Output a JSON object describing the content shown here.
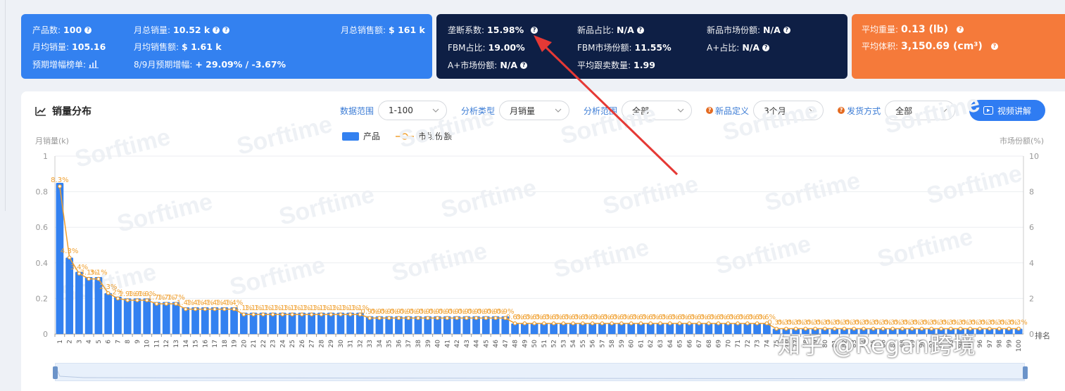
{
  "summary_blue": {
    "product_count_label": "产品数:",
    "product_count": "100",
    "monthly_sales_label": "月总销量:",
    "monthly_sales": "10.52 k",
    "monthly_revenue_label": "月总销售额:",
    "monthly_revenue": "$ 161 k",
    "avg_sales_label": "月均销量:",
    "avg_sales": "105.16",
    "avg_revenue_label": "月均销售额:",
    "avg_revenue": "$ 1.61 k",
    "forecast_label": "预期增幅榜单:",
    "aug_sep_label": "8/9月预期增幅:",
    "aug_sep_value": "+ 29.09% / -3.67%"
  },
  "summary_navy": {
    "monopoly_label": "垄断系数:",
    "monopoly_value": "15.98%",
    "new_ratio_label": "新品占比:",
    "new_ratio_value": "N/A",
    "new_share_label": "新品市场份额:",
    "new_share_value": "N/A",
    "fbm_ratio_label": "FBM占比:",
    "fbm_ratio_value": "19.00%",
    "fbm_share_label": "FBM市场份额:",
    "fbm_share_value": "11.55%",
    "aplus_ratio_label": "A+占比:",
    "aplus_ratio_value": "N/A",
    "aplus_share_label": "A+市场份额:",
    "aplus_share_value": "N/A",
    "avg_sellers_label": "平均跟卖数量:",
    "avg_sellers_value": "1.99"
  },
  "summary_orange": {
    "avg_weight_label": "平均重量:",
    "avg_weight_value": "0.13 (lb)",
    "avg_volume_label": "平均体积:",
    "avg_volume_value": "3,150.69 (cm³)"
  },
  "panel": {
    "title": "销量分布",
    "filters": [
      {
        "label": "数据范围",
        "value": "1-100",
        "width": 98,
        "warn": false
      },
      {
        "label": "分析类型",
        "value": "月销量",
        "width": 100,
        "warn": false
      },
      {
        "label": "分析范围",
        "value": "全部",
        "width": 100,
        "warn": false
      },
      {
        "label": "新品定义",
        "value": "3个月",
        "width": 100,
        "warn": true
      },
      {
        "label": "发货方式",
        "value": "全部",
        "width": 100,
        "warn": true
      }
    ],
    "video_button": "视频讲解",
    "legend_bar": "产品",
    "legend_line": "市场份额",
    "y_left_label": "月销量(k)",
    "y_right_label": "市场份额(%)",
    "x_axis_name": "排名",
    "watermark": "知乎 @Regan跨境",
    "watermark_repeat": "Sorftime"
  },
  "colors": {
    "bar": "#3381f0",
    "line": "#f0a030",
    "blue_card": "#3381f0",
    "navy_card": "#0e1f45",
    "orange_card": "#f57a3a",
    "arrow": "#e53935"
  },
  "chart_data": {
    "type": "bar",
    "xlabel": "排名",
    "ylabel": "月销量(k)",
    "y2label": "市场份额(%)",
    "ylim": [
      0,
      1
    ],
    "y2lim": [
      0,
      10
    ],
    "series": [
      {
        "name": "产品",
        "type": "bar",
        "values": [
          0.85,
          0.43,
          0.35,
          0.32,
          0.32,
          0.23,
          0.21,
          0.2,
          0.2,
          0.2,
          0.18,
          0.18,
          0.18,
          0.15,
          0.15,
          0.15,
          0.15,
          0.15,
          0.15,
          0.12,
          0.12,
          0.12,
          0.12,
          0.12,
          0.12,
          0.12,
          0.12,
          0.12,
          0.12,
          0.12,
          0.12,
          0.12,
          0.1,
          0.1,
          0.1,
          0.1,
          0.1,
          0.1,
          0.1,
          0.1,
          0.1,
          0.1,
          0.1,
          0.1,
          0.1,
          0.1,
          0.1,
          0.06,
          0.06,
          0.06,
          0.06,
          0.06,
          0.06,
          0.06,
          0.06,
          0.06,
          0.06,
          0.06,
          0.06,
          0.06,
          0.06,
          0.06,
          0.06,
          0.06,
          0.06,
          0.06,
          0.06,
          0.06,
          0.06,
          0.06,
          0.06,
          0.06,
          0.06,
          0.06,
          0.03,
          0.03,
          0.03,
          0.03,
          0.03,
          0.03,
          0.03,
          0.03,
          0.03,
          0.03,
          0.03,
          0.03,
          0.03,
          0.03,
          0.03,
          0.03,
          0.03,
          0.03,
          0.03,
          0.03,
          0.03,
          0.03,
          0.03,
          0.03,
          0.03,
          0.03
        ]
      },
      {
        "name": "市场份额",
        "type": "line",
        "values": [
          8.3,
          4.3,
          3.4,
          3.1,
          3.1,
          2.3,
          2,
          1.9,
          1.9,
          1.9,
          1.7,
          1.7,
          1.7,
          1.4,
          1.4,
          1.4,
          1.4,
          1.4,
          1.4,
          1.1,
          1.1,
          1.1,
          1.1,
          1.1,
          1.1,
          1.1,
          1.1,
          1.1,
          1.1,
          1.1,
          1.1,
          1.1,
          0.9,
          0.9,
          0.9,
          0.9,
          0.9,
          0.9,
          0.9,
          0.9,
          0.9,
          0.9,
          0.9,
          0.9,
          0.9,
          0.9,
          0.9,
          0.6,
          0.6,
          0.6,
          0.6,
          0.6,
          0.6,
          0.6,
          0.6,
          0.6,
          0.6,
          0.6,
          0.6,
          0.6,
          0.6,
          0.6,
          0.6,
          0.6,
          0.6,
          0.6,
          0.6,
          0.6,
          0.6,
          0.6,
          0.6,
          0.6,
          0.6,
          0.6,
          0.3,
          0.3,
          0.3,
          0.3,
          0.3,
          0.3,
          0.3,
          0.3,
          0.3,
          0.3,
          0.3,
          0.3,
          0.3,
          0.3,
          0.3,
          0.3,
          0.3,
          0.3,
          0.3,
          0.3,
          0.3,
          0.3,
          0.3,
          0.3,
          0.3,
          0.3
        ],
        "data_labels": [
          "8.3%",
          "4.3%",
          "3.4%",
          "3.1%",
          "3.1%",
          "2.3%",
          "2%",
          "1.9%",
          "1.9%",
          "1.9%",
          "1.7%",
          "1.7%",
          "1.7%",
          "1.4%",
          "1.4%",
          "1.4%",
          "1.4%",
          "1.4%",
          "1.4%",
          "1.1%",
          "1.1%",
          "1.1%",
          "1.1%",
          "1.1%",
          "1.1%",
          "1.1%",
          "1.1%",
          "1.1%",
          "1.1%",
          "1.1%",
          "1.1%",
          "1.1%",
          "0.9%",
          "0.9%",
          "0.9%",
          "0.9%",
          "0.9%",
          "0.9%",
          "0.9%",
          "0.9%",
          "0.9%",
          "0.9%",
          "0.9%",
          "0.9%",
          "0.9%",
          "0.9%",
          "0.9%",
          "0.6%",
          "0.6%",
          "0.6%",
          "0.6%",
          "0.6%",
          "0.6%",
          "0.6%",
          "0.6%",
          "0.6%",
          "0.6%",
          "0.6%",
          "0.6%",
          "0.6%",
          "0.6%",
          "0.6%",
          "0.6%",
          "0.6%",
          "0.6%",
          "0.6%",
          "0.6%",
          "0.6%",
          "0.6%",
          "0.6%",
          "0.6%",
          "0.6%",
          "0.6%",
          "0.6%",
          "0.3%",
          "0.3%",
          "0.3%",
          "0.3%",
          "0.3%",
          "0.3%",
          "0.3%",
          "0.3%",
          "0.3%",
          "0.3%",
          "0.3%",
          "0.3%",
          "0.3%",
          "0.3%",
          "0.3%",
          "0.3%",
          "0.3%",
          "0.3%",
          "0.3%",
          "0.3%",
          "0.3%",
          "0.3%",
          "0.3%",
          "0.3%",
          "0.3%",
          "0.3%"
        ]
      }
    ],
    "yticks_left": [
      "0",
      "0.2",
      "0.4",
      "0.6",
      "0.8",
      "1"
    ],
    "yticks_right": [
      "0",
      "2",
      "4",
      "6",
      "8",
      "10"
    ],
    "xticks": [
      "1",
      "2",
      "3",
      "4",
      "5",
      "6",
      "7",
      "8",
      "9",
      "10",
      "11",
      "12",
      "13",
      "14",
      "15",
      "16",
      "17",
      "18",
      "19",
      "20",
      "21",
      "22",
      "23",
      "24",
      "25",
      "26",
      "27",
      "28",
      "29",
      "30",
      "31",
      "32",
      "33",
      "34",
      "35",
      "36",
      "37",
      "38",
      "39",
      "40",
      "41",
      "42",
      "43",
      "44",
      "45",
      "46",
      "47",
      "48",
      "49",
      "50",
      "51",
      "52",
      "53",
      "54",
      "55",
      "56",
      "57",
      "58",
      "59",
      "60",
      "61",
      "62",
      "63",
      "64",
      "65",
      "66",
      "67",
      "68",
      "69",
      "70",
      "71",
      "72",
      "73",
      "74",
      "75",
      "76",
      "77",
      "78",
      "79",
      "80",
      "81",
      "82",
      "83",
      "84",
      "85",
      "86",
      "87",
      "88",
      "89",
      "90",
      "91",
      "92",
      "93",
      "94",
      "95",
      "96",
      "97",
      "98",
      "99",
      "100"
    ],
    "grid": true,
    "legend": "top-center"
  }
}
